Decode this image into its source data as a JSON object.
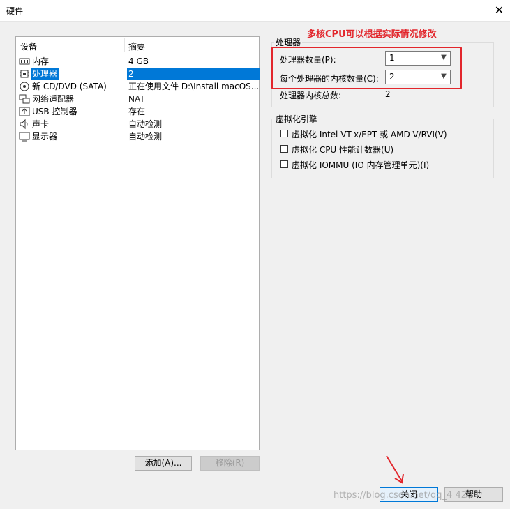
{
  "window": {
    "title": "硬件"
  },
  "device_list": {
    "header_device": "设备",
    "header_summary": "摘要",
    "rows": [
      {
        "icon": "memory-icon",
        "name": "内存",
        "value": "4 GB"
      },
      {
        "icon": "processor-icon",
        "name": "处理器",
        "value": "2"
      },
      {
        "icon": "cd-dvd-icon",
        "name": "新 CD/DVD (SATA)",
        "value": "正在使用文件 D:\\Install macOS..."
      },
      {
        "icon": "network-adapter-icon",
        "name": "网络适配器",
        "value": "NAT"
      },
      {
        "icon": "usb-icon",
        "name": "USB 控制器",
        "value": "存在"
      },
      {
        "icon": "sound-card-icon",
        "name": "声卡",
        "value": "自动检测"
      },
      {
        "icon": "display-icon",
        "name": "显示器",
        "value": "自动检测"
      }
    ],
    "selected_index": 1
  },
  "processor_group": {
    "title": "处理器",
    "count_label": "处理器数量(P):",
    "count_value": "1",
    "cores_label": "每个处理器的内核数量(C):",
    "cores_value": "2",
    "total_label": "处理器内核总数:",
    "total_value": "2"
  },
  "virt_group": {
    "title": "虚拟化引擎",
    "options": [
      {
        "label": "虚拟化 Intel VT-x/EPT 或 AMD-V/RVI(V)",
        "checked": false
      },
      {
        "label": "虚拟化 CPU 性能计数器(U)",
        "checked": false
      },
      {
        "label": "虚拟化 IOMMU (IO 内存管理单元)(I)",
        "checked": false
      }
    ]
  },
  "buttons": {
    "add": "添加(A)...",
    "remove": "移除(R)",
    "close": "关闭",
    "help": "帮助"
  },
  "annotation": {
    "text": "多核CPU可以根据实际情况修改",
    "color": "#e2262c"
  },
  "watermark": "https://blog.csdn.net/qq_4   420"
}
